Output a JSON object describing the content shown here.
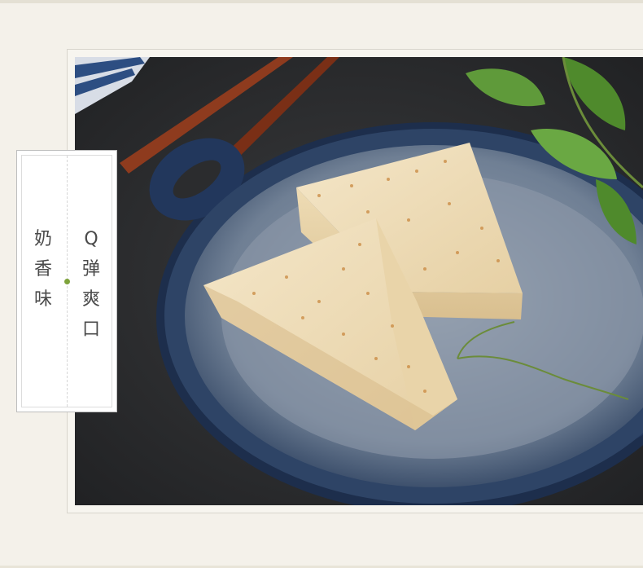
{
  "label": {
    "left_column": [
      "奶",
      "香",
      "味"
    ],
    "right_column": [
      "Q",
      "弹",
      "爽",
      "口"
    ],
    "accent_color": "#7ea33b"
  },
  "photo": {
    "icons": [
      "plate-icon",
      "cake-slice-icon",
      "leaf-icon",
      "chopsticks-icon"
    ]
  }
}
